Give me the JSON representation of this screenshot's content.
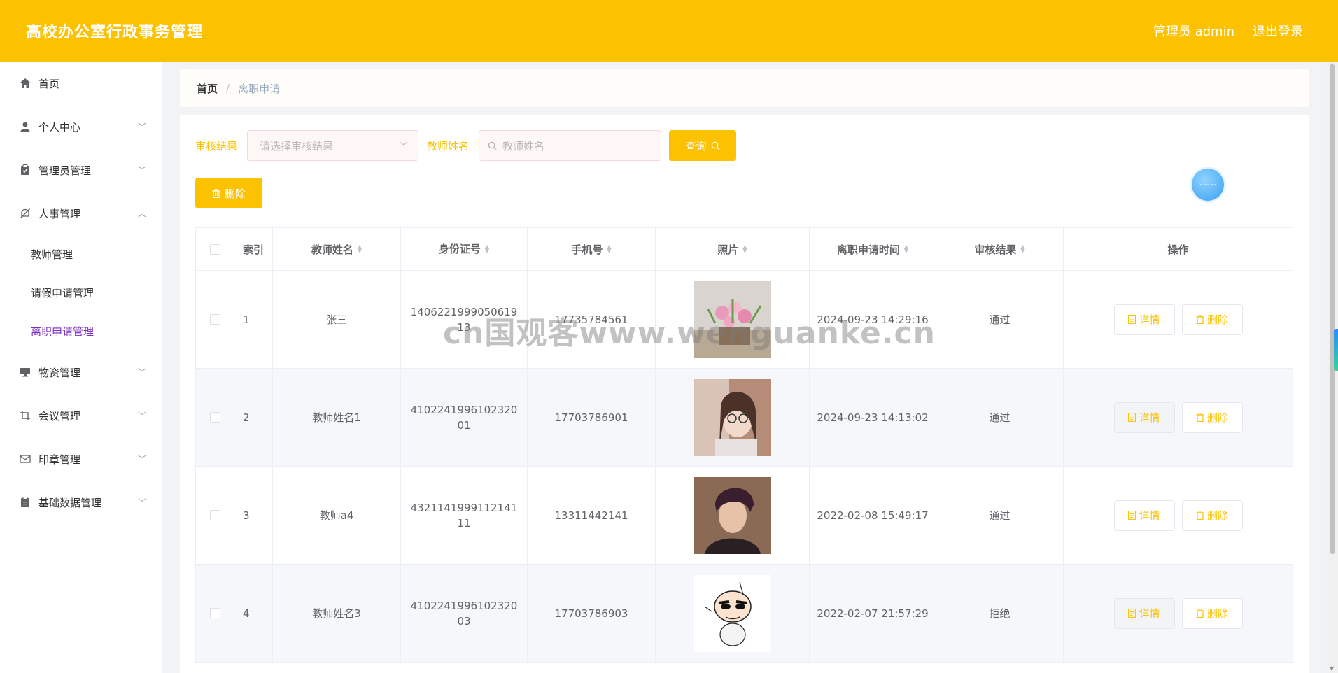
{
  "header": {
    "title": "高校办公室行政事务管理",
    "user": "管理员 admin",
    "logout": "退出登录"
  },
  "sidebar": {
    "items": [
      {
        "label": "首页",
        "icon": "home-icon"
      },
      {
        "label": "个人中心",
        "icon": "user-icon"
      },
      {
        "label": "管理员管理",
        "icon": "clipboard-check-icon"
      },
      {
        "label": "人事管理",
        "icon": "bell-off-icon"
      },
      {
        "label": "物资管理",
        "icon": "monitor-icon"
      },
      {
        "label": "会议管理",
        "icon": "crop-icon"
      },
      {
        "label": "印章管理",
        "icon": "mail-icon"
      },
      {
        "label": "基础数据管理",
        "icon": "clipboard-icon"
      }
    ],
    "sub_items": [
      {
        "label": "教师管理"
      },
      {
        "label": "请假申请管理"
      },
      {
        "label": "离职申请管理"
      }
    ]
  },
  "breadcrumb": {
    "home": "首页",
    "separator": "/",
    "current": "离职申请"
  },
  "search": {
    "result_label": "审核结果",
    "result_placeholder": "请选择审核结果",
    "name_label": "教师姓名",
    "name_placeholder": "教师姓名",
    "query_button": "查询",
    "delete_button": "删除"
  },
  "table": {
    "columns": [
      "索引",
      "教师姓名",
      "身份证号",
      "手机号",
      "照片",
      "离职申请时间",
      "审核结果",
      "操作"
    ],
    "rows": [
      {
        "index": "1",
        "name": "张三",
        "id_card": "140622199905061913",
        "phone": "17735784561",
        "time": "2024-09-23 14:29:16",
        "result": "通过"
      },
      {
        "index": "2",
        "name": "教师姓名1",
        "id_card": "410224199610232001",
        "phone": "17703786901",
        "time": "2024-09-23 14:13:02",
        "result": "通过"
      },
      {
        "index": "3",
        "name": "教师a4",
        "id_card": "432114199911214111",
        "phone": "13311442141",
        "time": "2022-02-08 15:49:17",
        "result": "通过"
      },
      {
        "index": "4",
        "name": "教师姓名3",
        "id_card": "410224199610232003",
        "phone": "17703786903",
        "time": "2022-02-07 21:57:29",
        "result": "拒绝"
      }
    ],
    "detail_button": "详情",
    "delete_button": "删除"
  },
  "watermark": "cn国观客www.wenguanke.cn",
  "colors": {
    "accent": "#fcc200",
    "active_menu": "#7b2fbf"
  }
}
